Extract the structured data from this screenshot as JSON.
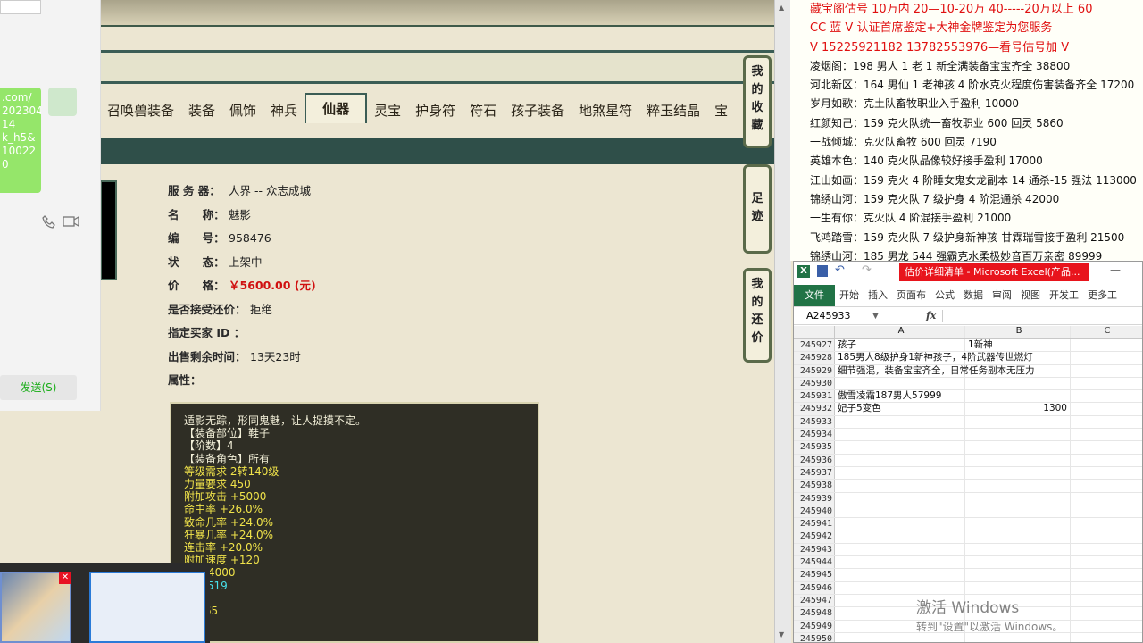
{
  "game": {
    "tabs": [
      "召唤兽装备",
      "装备",
      "佩饰",
      "神兵",
      "仙器",
      "灵宝",
      "护身符",
      "符石",
      "孩子装备",
      "地煞星符",
      "粹玉结晶",
      "宝"
    ],
    "active_tab": "仙器",
    "info": [
      {
        "label": "服 务 器：",
        "value": "人界 -- 众志成城"
      },
      {
        "label": "名      称：",
        "value": "魅影"
      },
      {
        "label": "编      号：",
        "value": "958476"
      },
      {
        "label": "状      态：",
        "value": "上架中"
      },
      {
        "label": "价      格：",
        "value": "￥5600.00 (元)"
      },
      {
        "label": "是否接受还价：",
        "value": "拒绝"
      },
      {
        "label": "指定买家 ID ：",
        "value": ""
      },
      {
        "label": "出售剩余时间：",
        "value": "13天23时"
      },
      {
        "label": "属性：",
        "value": ""
      }
    ],
    "side_buttons": [
      "我的收藏",
      "足迹",
      "我的还价"
    ],
    "detail_lines": [
      {
        "text": "遁影无踪，形同鬼魅，让人捉摸不定。",
        "color": "w"
      },
      {
        "text": "【装备部位】鞋子",
        "color": "w"
      },
      {
        "text": "【阶数】4",
        "color": "w"
      },
      {
        "text": "【装备角色】所有",
        "color": "w"
      },
      {
        "text": "等级需求 2转140级",
        "color": "y"
      },
      {
        "text": "力量要求 450",
        "color": "y"
      },
      {
        "text": "附加攻击 +5000",
        "color": "y"
      },
      {
        "text": "命中率 +26.0%",
        "color": "y"
      },
      {
        "text": "致命几率 +24.0%",
        "color": "y"
      },
      {
        "text": "狂暴几率 +24.0%",
        "color": "y"
      },
      {
        "text": "连击率 +20.0%",
        "color": "y"
      },
      {
        "text": "附加速度 +120",
        "color": "y"
      },
      {
        "text": "                 000/4000",
        "color": "y"
      },
      {
        "text": "                 冰 +519",
        "color": "c"
      },
      {
        "text": "",
        "color": "y"
      },
      {
        "text": "                 41965",
        "color": "y"
      }
    ]
  },
  "chat": {
    "bubble_lines": [
      ".com/",
      "202304",
      "14",
      "k_h5&",
      "10022",
      "0"
    ],
    "send_label": "发送(S)"
  },
  "notes": {
    "lines": [
      {
        "text": "藏宝阁估号 10万内 20—10-20万 40-----20万以上 60",
        "red": true
      },
      {
        "text": "CC 蓝 V 认证首席鉴定+大神金牌鉴定为您服务",
        "red": true
      },
      {
        "text": "V 15225921182      13782553976—看号估号加 V",
        "red": true
      },
      {
        "text": "凌烟阁：198 男人 1 老 1 新全满装备宝宝齐全 38800",
        "red": false
      },
      {
        "text": "河北新区：164 男仙 1 老神孩 4 阶水克火程度伤害装备齐全 17200",
        "red": false
      },
      {
        "text": "岁月如歌：克土队畜牧职业入手盈利 10000",
        "red": false
      },
      {
        "text": "红颜知己：159 克火队统一畜牧职业 600 回灵 5860",
        "red": false
      },
      {
        "text": "一战倾城：克火队畜牧 600 回灵 7190",
        "red": false
      },
      {
        "text": "英雄本色：140 克火队品像较好接手盈利 17000",
        "red": false
      },
      {
        "text": "江山如画：159 克火 4 阶睡女鬼女龙副本 14 通杀-15 强法 113000",
        "red": false
      },
      {
        "text": "锦绣山河：159 克火队 7 级护身 4 阶混通杀 42000",
        "red": false
      },
      {
        "text": "一生有你：克火队 4 阶混接手盈利 21000",
        "red": false
      },
      {
        "text": "飞鸿踏雪：159 克火队 7 级护身新神孩-甘霖瑞雪接手盈利 21500",
        "red": false
      },
      {
        "text": "锦绣山河：185 男龙 544 强霸克水柔极妙音百万亲密 89999",
        "red": false
      }
    ]
  },
  "excel": {
    "title": "估价详细清单 - Microsoft Excel(产品...",
    "ribbon": [
      "文件",
      "开始",
      "插入",
      "页面布",
      "公式",
      "数据",
      "审阅",
      "视图",
      "开发工",
      "更多工"
    ],
    "name_box": "A245933",
    "columns": [
      "A",
      "B",
      "C"
    ],
    "rows": [
      {
        "n": "245927",
        "a": "孩子",
        "b": "1新神"
      },
      {
        "n": "245928",
        "a": "185男人8级护身1新神孩子，4阶武器传世燃灯",
        "b": ""
      },
      {
        "n": "245929",
        "a": "细节强混，装备宝宝齐全，日常任务副本无压力",
        "b": ""
      },
      {
        "n": "245930",
        "a": "",
        "b": ""
      },
      {
        "n": "245931",
        "a": "傲雪凌霜187男人57999",
        "b": ""
      },
      {
        "n": "245932",
        "a": "妃子5变色",
        "b": "1300"
      },
      {
        "n": "245933",
        "a": "",
        "b": ""
      },
      {
        "n": "245934",
        "a": "",
        "b": ""
      },
      {
        "n": "245935",
        "a": "",
        "b": ""
      },
      {
        "n": "245936",
        "a": "",
        "b": ""
      },
      {
        "n": "245937",
        "a": "",
        "b": ""
      },
      {
        "n": "245938",
        "a": "",
        "b": ""
      },
      {
        "n": "245939",
        "a": "",
        "b": ""
      },
      {
        "n": "245940",
        "a": "",
        "b": ""
      },
      {
        "n": "245941",
        "a": "",
        "b": ""
      },
      {
        "n": "245942",
        "a": "",
        "b": ""
      },
      {
        "n": "245943",
        "a": "",
        "b": ""
      },
      {
        "n": "245944",
        "a": "",
        "b": ""
      },
      {
        "n": "245945",
        "a": "",
        "b": ""
      },
      {
        "n": "245946",
        "a": "",
        "b": ""
      },
      {
        "n": "245947",
        "a": "",
        "b": ""
      },
      {
        "n": "245948",
        "a": "",
        "b": ""
      },
      {
        "n": "245949",
        "a": "",
        "b": ""
      },
      {
        "n": "245950",
        "a": "",
        "b": ""
      },
      {
        "n": "245951",
        "a": "",
        "b": ""
      }
    ]
  },
  "watermark": {
    "line1": "激活 Windows",
    "line2": "转到\"设置\"以激活 Windows。"
  }
}
